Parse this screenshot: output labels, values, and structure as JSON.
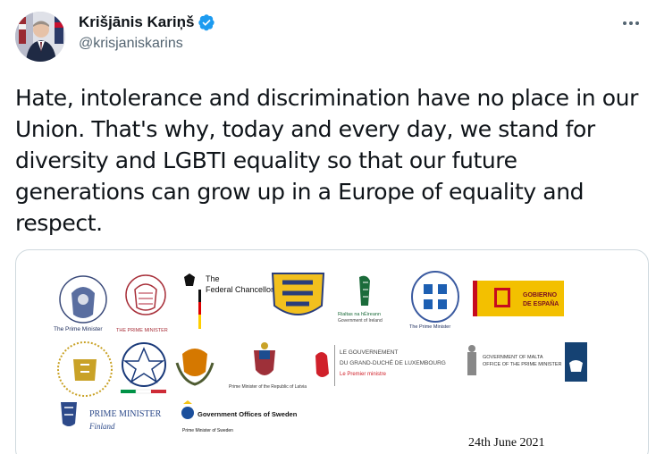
{
  "author": {
    "display_name": "Krišjānis Kariņš",
    "handle": "@krisjaniskarins",
    "verified": true
  },
  "tweet": {
    "text": "Hate, intolerance and discrimination have no place in our Union. That's why, today and every day, we stand for diversity and LGBTI equality so that our future generations can grow up in a Europe of equality and respect."
  },
  "icons": {
    "verified": "verified-badge-icon",
    "more": "more-options-icon"
  },
  "colors": {
    "verified_blue": "#1d9bf0",
    "handle_gray": "#536471",
    "border": "#cfd9de"
  },
  "media": {
    "logos": {
      "belgium": "The Prime Minister",
      "luxembourg_pm_red": "THE PRIME MINISTER",
      "germany_line1": "The",
      "germany_line2": "Federal Chancellor",
      "ireland_line1": "Rialtas na hÉireann",
      "ireland_line2": "Government of Ireland",
      "greece": "The Prime Minister",
      "spain_line1": "GOBIERNO",
      "spain_line2": "DE ESPAÑA",
      "latvia": "Prime Minister of the Republic of Latvia",
      "lux_line1": "LE GOUVERNEMENT",
      "lux_line2": "DU GRAND-DUCHÉ DE LUXEMBOURG",
      "lux_line3": "Le Premier ministre",
      "malta_line1": "GOVERNMENT OF MALTA",
      "malta_line2": "OFFICE OF THE PRIME MINISTER",
      "finland_line1": "PRIME MINISTER",
      "finland_line2": "Finland",
      "sweden_line1": "Government Offices of Sweden",
      "sweden_line2": "Prime Minister of Sweden"
    },
    "date": "24th June 2021"
  }
}
